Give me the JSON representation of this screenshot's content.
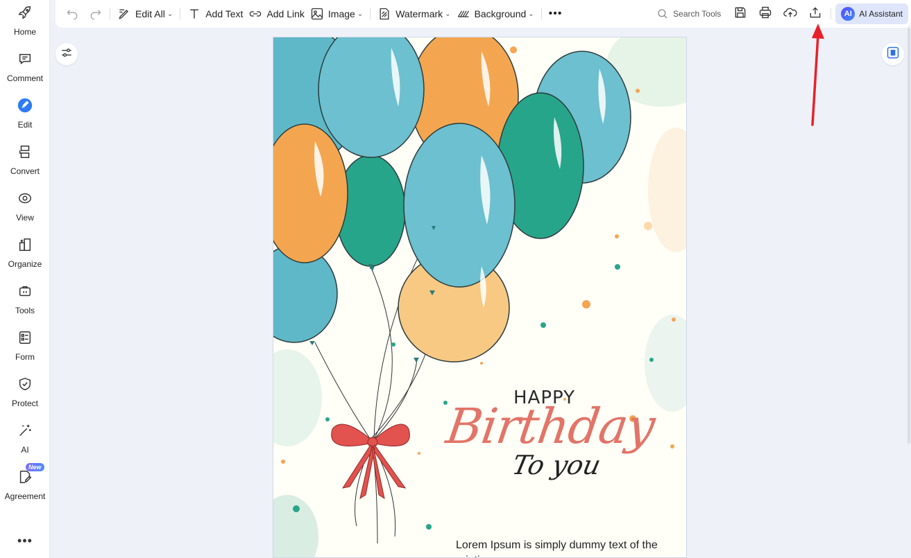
{
  "sidebar": {
    "items": [
      {
        "label": "Home",
        "icon": "rocket-icon"
      },
      {
        "label": "Comment",
        "icon": "comment-icon"
      },
      {
        "label": "Edit",
        "icon": "edit-pen-icon"
      },
      {
        "label": "Convert",
        "icon": "convert-icon"
      },
      {
        "label": "View",
        "icon": "eye-icon"
      },
      {
        "label": "Organize",
        "icon": "organize-icon"
      },
      {
        "label": "Tools",
        "icon": "toolbox-icon"
      },
      {
        "label": "Form",
        "icon": "form-icon"
      },
      {
        "label": "Protect",
        "icon": "shield-icon"
      },
      {
        "label": "AI",
        "icon": "magic-wand-icon"
      },
      {
        "label": "Agreement",
        "icon": "agreement-icon",
        "badge": "New"
      }
    ],
    "more": "•••"
  },
  "toolbar": {
    "edit_all": "Edit All",
    "add_text": "Add Text",
    "add_link": "Add Link",
    "image": "Image",
    "watermark": "Watermark",
    "background": "Background",
    "more": "•••",
    "search_tools": "Search Tools",
    "ai_logo": "AI",
    "ai_assistant": "AI Assistant"
  },
  "document": {
    "happy": "HAPPY",
    "birthday": "Birthday",
    "to_you": "To you",
    "lorem": "Lorem Ipsum is simply dummy text of the printing"
  },
  "colors": {
    "accent": "#3a6df0",
    "annotation_arrow": "#e8202a",
    "birthday_text": "#e27468",
    "balloon_teal": "#5fb8c8",
    "balloon_orange": "#f3a64f",
    "balloon_green": "#27a58a",
    "balloon_light_orange": "#f7c983",
    "ribbon": "#e2524f"
  }
}
